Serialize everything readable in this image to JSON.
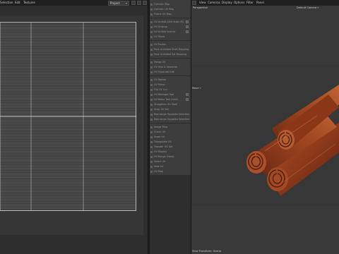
{
  "uv_editor": {
    "menu": [
      "Selection",
      "Edit",
      "Textures"
    ],
    "dropdown_value": "Project",
    "dropdown_arrow": "▾"
  },
  "side_menu": {
    "groups": [
      {
        "items": [
          {
            "label": "Cylinder Map",
            "check": false
          },
          {
            "label": "Cylinder UV Map",
            "check": false
          },
          {
            "label": "Frame UV Map",
            "check": false
          }
        ]
      },
      {
        "items": [
          {
            "label": "UV Unfold (Grid auto UV)",
            "check": true
          },
          {
            "label": "UV Unwrap",
            "check": true
          },
          {
            "label": "UV Unfold Inverse",
            "check": true
          },
          {
            "label": "UV Stack",
            "check": false
          }
        ]
      },
      {
        "items": [
          {
            "label": "UV Packer",
            "check": false
          },
          {
            "label": "Pack Unfolded Shell Mapping",
            "check": false
          },
          {
            "label": "Pack Unfolded Sel Mapping",
            "check": false
          }
        ]
      },
      {
        "items": [
          {
            "label": "Merge UV",
            "check": false
          },
          {
            "label": "UV Sew & Separate",
            "check": false
          },
          {
            "label": "UV Separate Edit",
            "check": false
          }
        ]
      },
      {
        "items": [
          {
            "label": "UV Rotate",
            "check": false
          },
          {
            "label": "UV Mirror",
            "check": false
          },
          {
            "label": "Flip UV Cut",
            "check": false
          },
          {
            "label": "UV Reshape Tool",
            "check": true
          },
          {
            "label": "UV Relax Tool (Grid)",
            "check": true
          },
          {
            "label": "Straighten UV Shell",
            "check": false
          },
          {
            "label": "Snap UV Sel",
            "check": false
          },
          {
            "label": "Rearrange Opposite Selection",
            "check": false
          },
          {
            "label": "Rearrange Opposite Selection",
            "check": false
          }
        ]
      },
      {
        "items": [
          {
            "label": "Image Map",
            "check": false
          },
          {
            "label": "Check UV",
            "check": false
          },
          {
            "label": "Scale UV",
            "check": false
          },
          {
            "label": "Triangulate UV",
            "check": false
          },
          {
            "label": "Transfer UV Set",
            "check": false
          },
          {
            "label": "UV Display",
            "check": false
          },
          {
            "label": "UV Range Clamp",
            "check": false
          },
          {
            "label": "Select UV",
            "check": false
          },
          {
            "label": "Hide UV",
            "check": false
          },
          {
            "label": "UV Map",
            "check": false
          }
        ]
      }
    ]
  },
  "viewport": {
    "menu": [
      "View",
      "Cameras",
      "Display",
      "Options",
      "Filter",
      "Panel"
    ],
    "camera_mode": "Perspective",
    "camera_name": "Default Camera ▿",
    "axis_label": "Move ▿",
    "status": "View Transform: Scene",
    "colors": {
      "wood_dark": "#5e200e",
      "wood_mid": "#8f3a1a",
      "wood_light": "#b4582c"
    }
  }
}
